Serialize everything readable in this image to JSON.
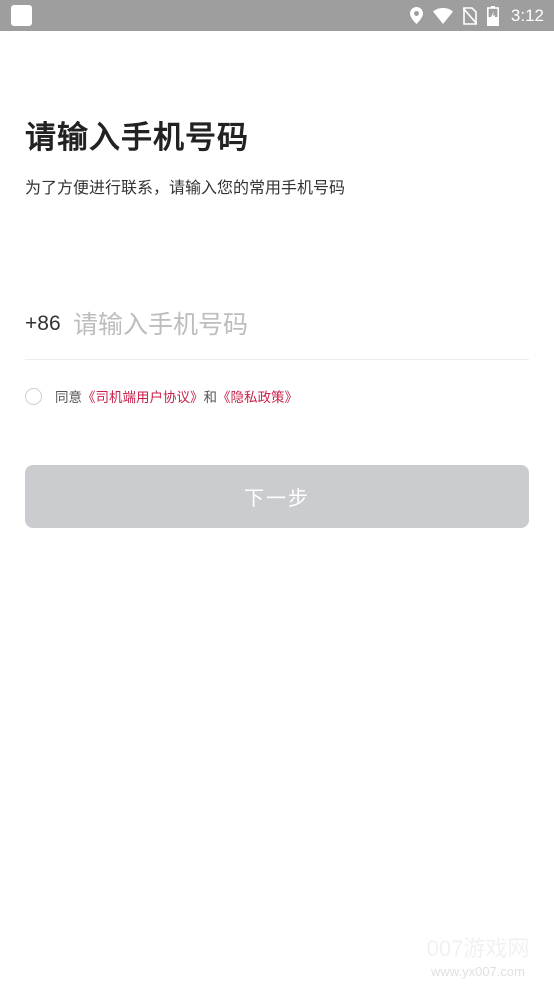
{
  "status_bar": {
    "time": "3:12",
    "icons": [
      "app-notification-icon",
      "location-icon",
      "wifi-icon",
      "no-sim-icon",
      "battery-charging-icon"
    ]
  },
  "main": {
    "title": "请输入手机号码",
    "subtitle": "为了方便进行联系，请输入您的常用手机号码",
    "phone": {
      "country_code": "+86",
      "placeholder": "请输入手机号码",
      "value": ""
    },
    "agreement": {
      "prefix": "同意",
      "user_agreement": "《司机端用户协议》",
      "conjunction": "和",
      "privacy_policy": "《隐私政策》",
      "checked": false
    },
    "next_button": "下一步"
  },
  "watermark": {
    "name": "007游戏网",
    "url": "www.yx007.com"
  },
  "colors": {
    "status_bar": "#9e9e9e",
    "link": "#c8224a",
    "button_disabled": "#cbccd0",
    "title": "#222222"
  }
}
